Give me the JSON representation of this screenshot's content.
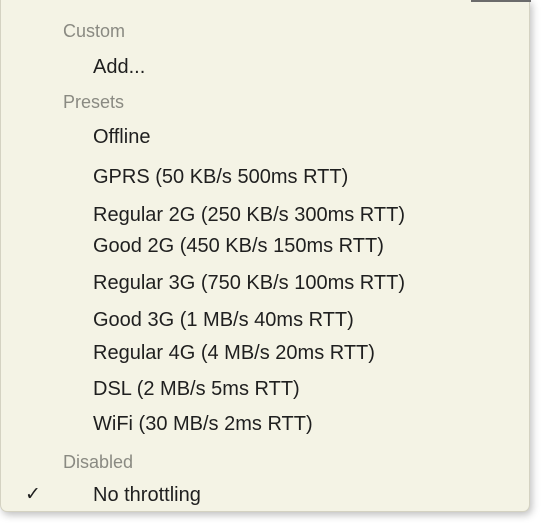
{
  "menu": {
    "sections": [
      {
        "header": "Custom",
        "items": [
          "Add..."
        ]
      },
      {
        "header": "Presets",
        "items": [
          "Offline",
          "GPRS (50 KB/s 500ms RTT)",
          "Regular 2G (250 KB/s 300ms RTT)",
          "Good 2G (450 KB/s 150ms RTT)",
          "Regular 3G (750 KB/s 100ms RTT)",
          "Good 3G (1 MB/s 40ms RTT)",
          "Regular 4G (4 MB/s 20ms RTT)",
          "DSL (2 MB/s 5ms RTT)",
          "WiFi (30 MB/s 2ms RTT)"
        ]
      },
      {
        "header": "Disabled",
        "items": [
          "No throttling"
        ]
      }
    ],
    "checkmark": "✓",
    "selected_item": "No throttling"
  }
}
